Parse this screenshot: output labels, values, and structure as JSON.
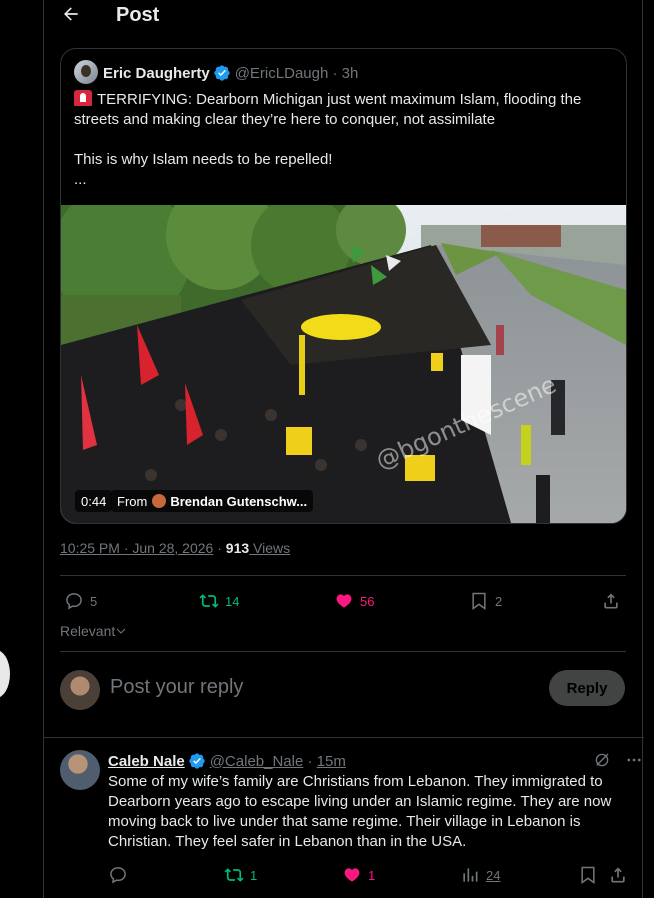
{
  "header": {
    "title": "Post"
  },
  "quoted_post": {
    "author_name": "Eric Daugherty",
    "handle": "@EricLDaugh",
    "time": "3h",
    "line1": "TERRIFYING: Dearborn Michigan just went maximum Islam, flooding the streets and making clear they’re here to conquer, not assimilate",
    "line2": "This is why Islam needs to be repelled!",
    "line3": "...",
    "video": {
      "duration": "0:44",
      "from_label": "From",
      "from_name": "Brendan Gutenschw...",
      "watermark": "@bgonthescene"
    }
  },
  "meta": {
    "timestamp": "10:25 PM · Jun 28, 2026",
    "separator": "·",
    "views_count": "913",
    "views_label": " Views"
  },
  "actions": {
    "replies": "5",
    "reposts": "14",
    "likes": "56",
    "bookmarks": "2"
  },
  "sort": {
    "label": "Relevant"
  },
  "composer": {
    "placeholder": "Post your reply",
    "button": "Reply"
  },
  "reply": {
    "author_name": "Caleb Nale",
    "handle": "@Caleb_Nale",
    "time": "15m",
    "text": "Some of my wife’s family are Christians from Lebanon. They immigrated to Dearborn years ago to escape living under an Islamic regime. They are now moving back to live under that same regime. Their village in Lebanon is Christian. They feel safer in Lebanon than in the USA.",
    "actions": {
      "replies": "",
      "reposts": "1",
      "likes": "1",
      "views": "24"
    }
  },
  "colors": {
    "accent_blue": "#1d9bf0",
    "repost_green": "#00ba7c",
    "like_pink": "#f91880",
    "muted": "#71767b",
    "border": "#2f3336"
  },
  "icons": [
    "back-arrow-icon",
    "verified-badge-icon",
    "reply-icon",
    "repost-icon",
    "like-icon",
    "bookmark-icon",
    "share-icon",
    "views-icon",
    "more-icon",
    "grok-icon",
    "chevron-down-icon",
    "siren-emoji-icon"
  ]
}
